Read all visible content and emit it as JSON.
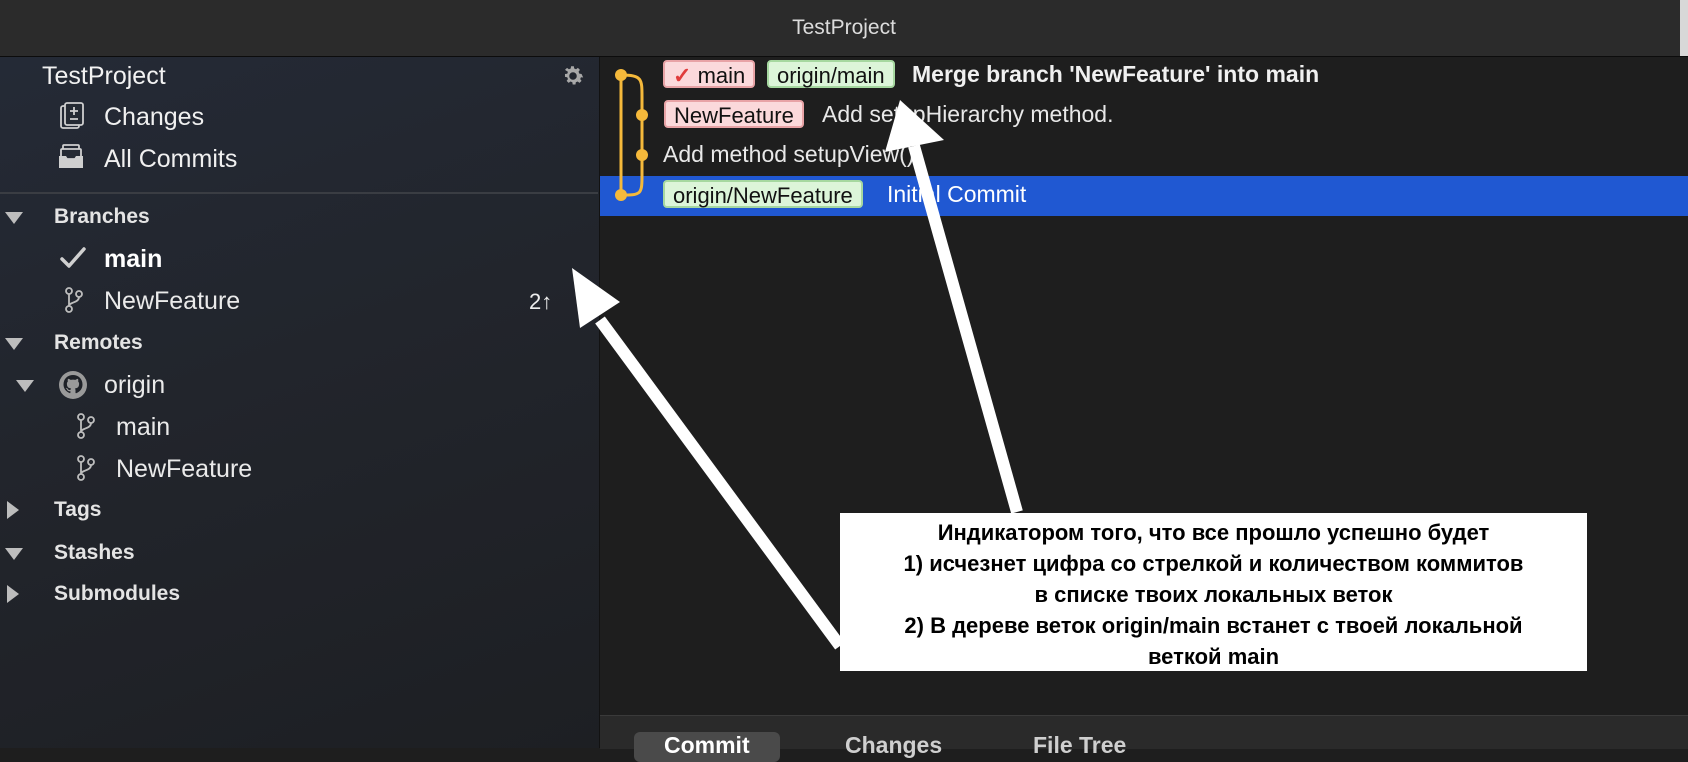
{
  "window": {
    "title": "TestProject"
  },
  "sidebar": {
    "project_title": "TestProject",
    "nav": [
      {
        "label": "Changes",
        "icon": "changes-icon"
      },
      {
        "label": "All Commits",
        "icon": "all-commits-icon"
      }
    ],
    "sections": {
      "branches": "Branches",
      "remotes": "Remotes",
      "tags": "Tags",
      "stashes": "Stashes",
      "submodules": "Submodules"
    },
    "branches": [
      {
        "name": "main",
        "current": true
      },
      {
        "name": "NewFeature",
        "ahead": "2↑"
      }
    ],
    "remotes": [
      {
        "name": "origin",
        "branches": [
          "main",
          "NewFeature"
        ]
      }
    ]
  },
  "commits": [
    {
      "tags": [
        {
          "label": "main",
          "kind": "local",
          "check": true
        },
        {
          "label": "origin/main",
          "kind": "remote"
        }
      ],
      "message": "Merge branch 'NewFeature' into main"
    },
    {
      "tags": [
        {
          "label": "NewFeature",
          "kind": "local"
        }
      ],
      "message": "Add setupHierarchy method."
    },
    {
      "tags": [],
      "message": "Add method setupView()"
    },
    {
      "tags": [
        {
          "label": "origin/NewFeature",
          "kind": "remote"
        }
      ],
      "message": "Initial Commit",
      "selected": true
    }
  ],
  "bottom_tabs": [
    "Commit",
    "Changes",
    "File Tree"
  ],
  "annotation": {
    "lines": [
      "Индикатором того,  что все прошло успешно будет",
      "1) исчезнет цифра со стрелкой и количеством коммитов",
      "в списке твоих локальных веток",
      "2) В дереве веток origin/main встанет с твоей локальной",
      "веткой main"
    ]
  },
  "colors": {
    "selection": "#2058d2",
    "graph_line": "#f5b93b",
    "local_tag_bg": "#fbd9db",
    "remote_tag_bg": "#dcf5d9"
  }
}
